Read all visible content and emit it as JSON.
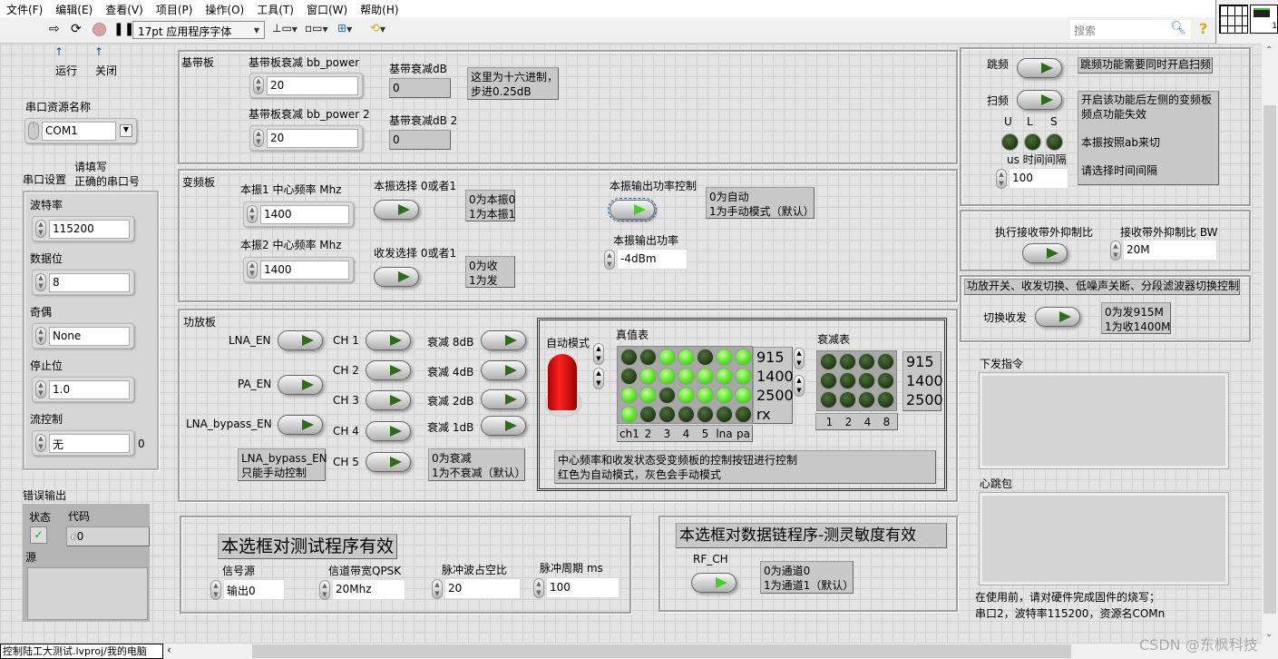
{
  "menu": [
    "文件(F)",
    "编辑(E)",
    "查看(V)",
    "项目(P)",
    "操作(O)",
    "工具(T)",
    "窗口(W)",
    "帮助(H)"
  ],
  "toolbar": {
    "font": "17pt 应用程序字体",
    "search_placeholder": "搜索",
    "help": "?"
  },
  "annotations": {
    "arrow": "↑",
    "run": "运行",
    "close": "关闭"
  },
  "serial": {
    "resource_label": "串口资源名称",
    "resource_value": "COM1",
    "settings_label": "串口设置",
    "hint1": "请填写",
    "hint2": "正确的串口号",
    "baud_label": "波特率",
    "baud": "115200",
    "databits_label": "数据位",
    "databits": "8",
    "parity_label": "奇偶",
    "parity": "None",
    "stopbits_label": "停止位",
    "stopbits": "1.0",
    "flow_label": "流控制",
    "flow": "无",
    "flow_num": "0"
  },
  "error": {
    "label": "错误输出",
    "status_label": "状态",
    "code_label": "代码",
    "code": "0",
    "code_prefix": "d",
    "source_label": "源"
  },
  "baseband": {
    "title": "基带板",
    "p1_label": "基带板衰减 bb_power",
    "p1": "20",
    "p2_label": "基带板衰减 bb_power 2",
    "p2": "20",
    "db1_label": "基带衰减dB",
    "db1": "0",
    "db2_label": "基带衰减dB 2",
    "db2": "0",
    "note1": "这里为十六进制，",
    "note2": "步进0.25dB"
  },
  "mixer": {
    "title": "变频板",
    "lo1_label": "本振1 中心频率 Mhz",
    "lo1": "1400",
    "lo2_label": "本振2 中心频率 Mhz",
    "lo2": "1400",
    "lo_sel_label": "本振选择 0或者1",
    "lo_sel_n1": "0为本振0",
    "lo_sel_n2": "1为本振1",
    "trx_label": "收发选择 0或者1",
    "trx_n1": "0为收",
    "trx_n2": "1为发",
    "pwr_ctrl_label": "本振输出功率控制",
    "pwr_ctrl_n1": "0为自动",
    "pwr_ctrl_n2": "1为手动模式（默认）",
    "pwr_label": "本振输出功率",
    "pwr": "-4dBm"
  },
  "pa": {
    "title": "功放板",
    "lna_en": "LNA_EN",
    "pa_en": "PA_EN",
    "lna_bypass": "LNA_bypass_EN",
    "bypass_n1": "LNA_bypass_EN",
    "bypass_n2": "只能手动控制",
    "channels": [
      "CH 1",
      "CH 2",
      "CH 3",
      "CH 4",
      "CH 5"
    ],
    "atten": [
      "衰减 8dB",
      "衰减 4dB",
      "衰减 2dB",
      "衰减 1dB"
    ],
    "atten_n1": "0为衰减",
    "atten_n2": "1为不衰减（默认）",
    "auto_label": "自动模式",
    "auto_on": true,
    "truth_title": "真值表",
    "truth_rows": [
      "915",
      "1400",
      "2500",
      "rx"
    ],
    "truth_cols": [
      "ch1",
      "2",
      "3",
      "4",
      "5",
      "lna",
      "pa"
    ],
    "truth": [
      [
        0,
        0,
        1,
        1,
        0,
        1,
        1
      ],
      [
        0,
        1,
        1,
        1,
        1,
        1,
        1
      ],
      [
        1,
        1,
        0,
        1,
        1,
        1,
        1
      ],
      [
        1,
        0,
        0,
        0,
        0,
        0,
        0
      ]
    ],
    "att_title": "衰减表",
    "att_rows": [
      "915",
      "1400",
      "2500"
    ],
    "att_cols": [
      "1",
      "2",
      "4",
      "8"
    ],
    "att": [
      [
        0,
        0,
        0,
        0
      ],
      [
        0,
        0,
        0,
        0
      ],
      [
        0,
        0,
        0,
        0
      ]
    ],
    "note1": "中心频率和收发状态受变频板的控制按钮进行控制",
    "note2": "红色为自动模式，灰色会手动模式"
  },
  "test": {
    "title": "本选框对测试程序有效",
    "src_label": "信号源",
    "src": "输出0",
    "bw_label": "信道带宽QPSK",
    "bw": "20Mhz",
    "duty_label": "脉冲波占空比",
    "duty": "20",
    "period_label": "脉冲周期 ms",
    "period": "100"
  },
  "datalink": {
    "title": "本选框对数据链程序-测灵敏度有效",
    "rf_label": "RF_CH",
    "n1": "0为通道0",
    "n2": "1为通道1（默认）"
  },
  "hop": {
    "hop_label": "跳频",
    "hop_note": "跳频功能需要同时开启扫频",
    "sweep_label": "扫频",
    "sweep_notes": [
      "开启该功能后左侧的变频板",
      "频点功能失效",
      "",
      "本振按照ab来切",
      "",
      "请选择时间间隔"
    ],
    "leds": [
      "U",
      "L",
      "S"
    ],
    "interval_label": "us 时间间隔",
    "interval": "100"
  },
  "oob": {
    "exec_label": "执行接收带外抑制比",
    "bw_label": "接收带外抑制比 BW",
    "bw": "20M"
  },
  "switch": {
    "title": "功放开关、收发切换、低噪声关断、分段滤波器切换控制",
    "trx_label": "切换收发",
    "n1": "0为发915M",
    "n2": "1为收1400M"
  },
  "cmd": {
    "send_label": "下发指令",
    "heartbeat_label": "心跳包",
    "notice1": "在使用前，请对硬件完成固件的烧写；",
    "notice2": "串口2，波特率115200，资源名COMn"
  },
  "status": {
    "path": "控制陆工大测试.lvproj/我的电脑"
  },
  "watermark": "CSDN @东枫科技"
}
